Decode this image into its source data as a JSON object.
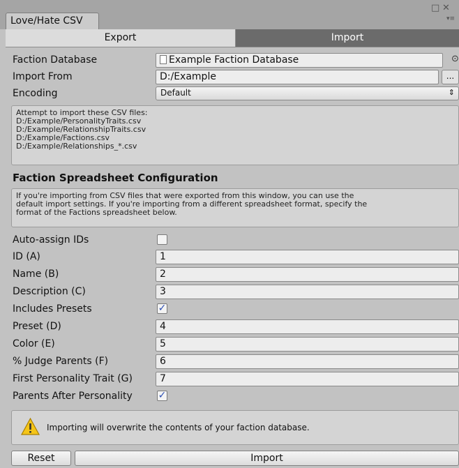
{
  "window": {
    "tab_title": "Love/Hate CSV",
    "controls": [
      "□",
      "✕",
      "▾≡"
    ]
  },
  "toolbar": {
    "export_label": "Export",
    "import_label": "Import",
    "selected": "Import"
  },
  "fields": {
    "faction_database": {
      "label": "Faction Database",
      "value": "Example Faction Database",
      "picker_icon": "⊙"
    },
    "import_from": {
      "label": "Import From",
      "value": "D:/Example",
      "browse_label": "..."
    },
    "encoding": {
      "label": "Encoding",
      "value": "Default",
      "arrow": "⇕"
    }
  },
  "files_box": {
    "heading": "Attempt to import these CSV files:",
    "files": [
      "D:/Example/PersonalityTraits.csv",
      "D:/Example/RelationshipTraits.csv",
      "D:/Example/Factions.csv",
      "D:/Example/Relationships_*.csv"
    ]
  },
  "spreadsheet_config": {
    "header": "Faction Spreadsheet Configuration",
    "help_lines": [
      "If you're importing from CSV files that were exported from this window, you can use the",
      "default import settings. If you're importing from a different spreadsheet format, specify the",
      "format of the Factions spreadsheet below."
    ],
    "rows": [
      {
        "label": "Auto-assign IDs",
        "type": "checkbox",
        "checked": false
      },
      {
        "label": "ID (A)",
        "type": "int",
        "value": "1"
      },
      {
        "label": "Name (B)",
        "type": "int",
        "value": "2"
      },
      {
        "label": "Description (C)",
        "type": "int",
        "value": "3"
      },
      {
        "label": "Includes Presets",
        "type": "checkbox",
        "checked": true
      },
      {
        "label": "Preset (D)",
        "type": "int",
        "value": "4"
      },
      {
        "label": "Color (E)",
        "type": "int",
        "value": "5"
      },
      {
        "label": "% Judge Parents (F)",
        "type": "int",
        "value": "6"
      },
      {
        "label": "First Personality Trait (G)",
        "type": "int",
        "value": "7"
      },
      {
        "label": "Parents After Personality",
        "type": "checkbox",
        "checked": true
      }
    ]
  },
  "warning": {
    "icon": "warning-icon",
    "text": "Importing will overwrite the contents of your faction database."
  },
  "buttons": {
    "reset_label": "Reset",
    "import_label": "Import"
  },
  "colors": {
    "selected_tab_bg": "#6b6b6b",
    "checkmark": "#2d4fb3",
    "warning_fill": "#f5c518"
  }
}
